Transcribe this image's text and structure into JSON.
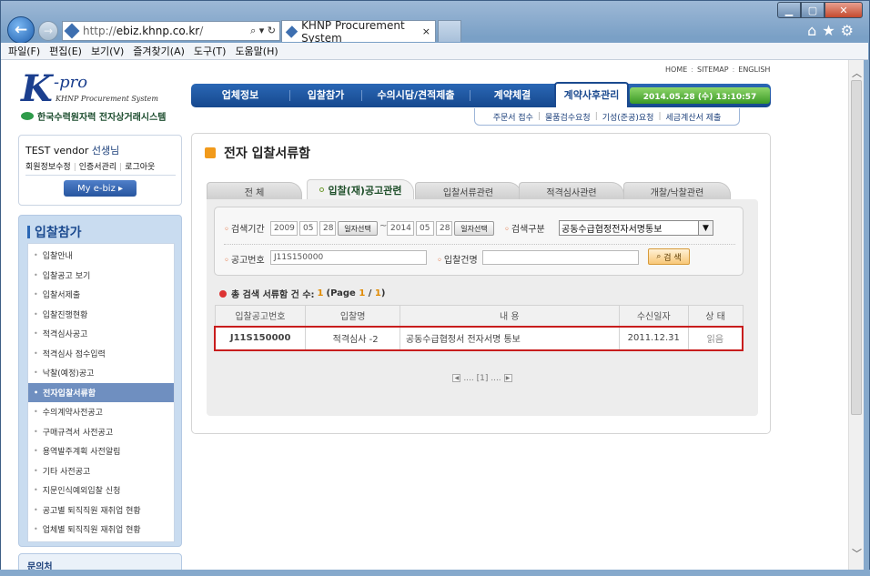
{
  "browser": {
    "url_prefix": "http://",
    "url_domain": "ebiz.khnp.co.kr",
    "url_suffix": "/",
    "address_controls": "⌕ ▾ ↻",
    "tab_title": "KHNP Procurement System",
    "tab_close": "×",
    "menu": [
      "파일(F)",
      "편집(E)",
      "보기(V)",
      "즐겨찾기(A)",
      "도구(T)",
      "도움말(H)"
    ]
  },
  "header": {
    "logo_k": "K",
    "logo_pro": "-pro",
    "logo_sub": "KHNP Procurement System",
    "company": "한국수력원자력 전자상거래시스템",
    "util_links": [
      "HOME",
      "SITEMAP",
      "ENGLISH"
    ]
  },
  "gnb": {
    "items": [
      "업체정보",
      "입찰참가",
      "수의시담/견적제출",
      "계약체결",
      "계약사후관리"
    ],
    "date": "2014.05.28 (수)  13:10:57",
    "sub_items": [
      "주문서 접수",
      "물품검수요청",
      "기성(준공)요청",
      "세금계산서 제출"
    ]
  },
  "user": {
    "name": "TEST vendor",
    "suffix": "선생님",
    "links": [
      "회원정보수정",
      "인증서관리",
      "로그아웃"
    ],
    "myebiz": "My e-biz  ▸"
  },
  "lnb": {
    "title": "입찰참가",
    "items": [
      "입찰안내",
      "입찰공고 보기",
      "입찰서제출",
      "입찰진행현황",
      "적격심사공고",
      "적격심사 점수입력",
      "낙찰(예정)공고",
      "전자입찰서류함",
      "수의계약사전공고",
      "구매규격서 사전공고",
      "용역발주계획 사전알림",
      "기타 사전공고",
      "지문인식예외입찰 신청",
      "공고별 퇴직직원 재취업 현황",
      "업체별 퇴직직원 재취업 현황"
    ],
    "active": "전자입찰서류함",
    "inquiry": "문의처"
  },
  "main": {
    "title": "전자 입찰서류함",
    "tabs": [
      "전    체",
      "입찰(재)공고관련",
      "입찰서류관련",
      "적격심사관련",
      "개찰/낙찰관련"
    ],
    "search": {
      "period_label": "검색기간",
      "from_year": "2009",
      "from_month": "05",
      "from_day": "28",
      "tilde": "~",
      "to_year": "2014",
      "to_month": "05",
      "to_day": "28",
      "date_button": "일자선택",
      "type_label": "검색구분",
      "type_value": "공동수급협정전자서명통보",
      "notice_label": "공고번호",
      "notice_value": "J11S150000",
      "name_label": "입찰건명",
      "name_value": "",
      "search_button": "검 색"
    },
    "count": {
      "prefix": "총 검색 서류함 건 수:",
      "total": "1",
      "page_open": "(Page",
      "page": "1",
      "slash": "/",
      "pages": "1",
      "page_close": ")"
    },
    "table": {
      "headers": [
        "입찰공고번호",
        "입찰명",
        "내 용",
        "수신일자",
        "상 태"
      ],
      "rows": [
        [
          "J11S150000",
          "적격심사 -2",
          "공동수급협정서 전자서명 통보",
          "2011.12.31",
          "읽음"
        ]
      ]
    },
    "pager": "....  [1]  ...."
  }
}
